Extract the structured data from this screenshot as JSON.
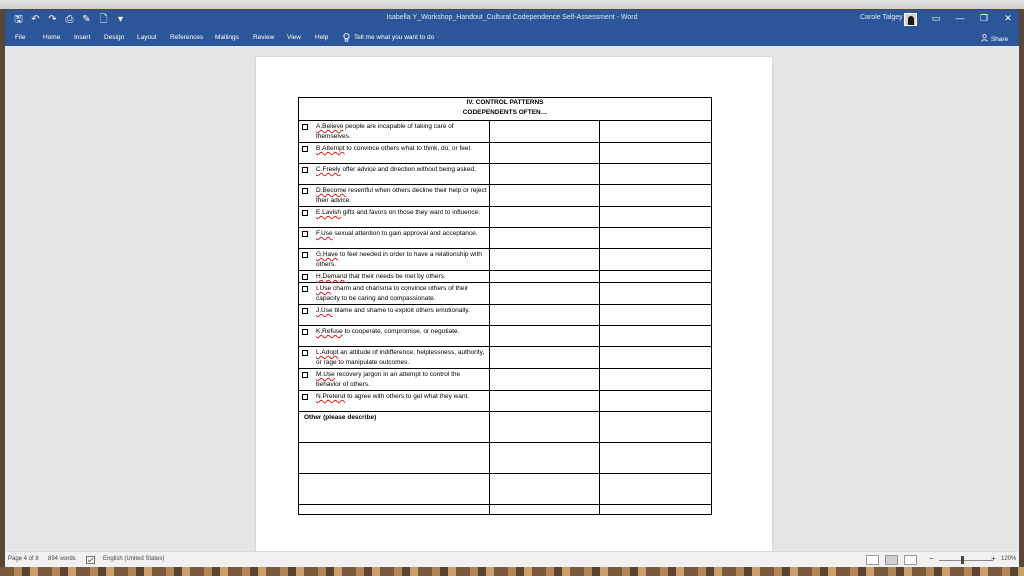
{
  "window": {
    "title": "Isabella Y_Workshop_Handout_Cultural Codependence Self-Assessment  -  Word",
    "user_name": "Carole Talgey",
    "controls": {
      "ribbon_display": "▭",
      "minimize": "—",
      "restore": "❐",
      "close": "✕"
    }
  },
  "quick_access": {
    "save": "🖫",
    "undo": "↶",
    "redo": "↷",
    "print_preview": "⎙",
    "format": "✎",
    "new": "🗋",
    "customize": "▾"
  },
  "ribbon": {
    "tabs": [
      "File",
      "Home",
      "Insert",
      "Design",
      "Layout",
      "References",
      "Mailings",
      "Review",
      "View",
      "Help"
    ],
    "tell_me": "Tell me what you want to do",
    "share": "Share"
  },
  "document": {
    "header_line1": "IV. CONTROL PATTERNS",
    "header_line2": "CODEPENDENTS OFTEN…",
    "items": [
      {
        "keyword": "A.Believe",
        "text": " people are incapable of taking care of themselves."
      },
      {
        "keyword": "B.Attempt",
        "text": " to convince others what to think, do, or feel."
      },
      {
        "keyword": "C.Freely",
        "text": " offer advice and direction without being asked."
      },
      {
        "keyword": "D.Become",
        "text": " resentful when others decline their help or reject their advice."
      },
      {
        "keyword": "E.Lavish",
        "text": " gifts and favors on those they want to influence."
      },
      {
        "keyword": "F.Use",
        "text": " sexual attention to gain approval and acceptance."
      },
      {
        "keyword": "G.Have",
        "text": " to feel needed in order to have a relationship with others."
      },
      {
        "keyword": "H.Demand",
        "text": " that their needs be met by others."
      },
      {
        "keyword": "I.Use",
        "text": " charm and charisma to convince others of their capacity to be caring and compassionate."
      },
      {
        "keyword": "J.Use",
        "text": " blame and shame to exploit others emotionally."
      },
      {
        "keyword": "K.Refuse",
        "text": " to cooperate, compromise, or negotiate."
      },
      {
        "keyword": "L.Adopt",
        "text": " an attitude of indifference, helplessness, authority, or rage to manipulate outcomes."
      },
      {
        "keyword": "M.Use",
        "text": " recovery jargon in an attempt to control the behavior of others."
      },
      {
        "keyword": "N.Pretend",
        "text": " to agree with others to get what they want."
      }
    ],
    "other_label": "Other (please describe)"
  },
  "status": {
    "page": "Page 4 of 8",
    "words": "894 words",
    "language": "English (United States)",
    "zoom": "120%",
    "zoom_minus": "−",
    "zoom_plus": "+"
  },
  "colors": {
    "title_bar": "#2b579a",
    "spell_underline": "#d12020"
  }
}
